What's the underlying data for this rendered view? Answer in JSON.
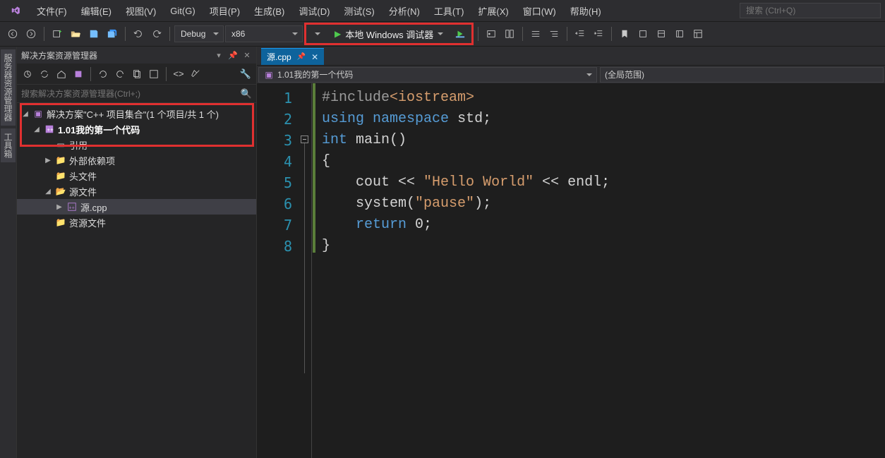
{
  "menu": {
    "file": "文件(F)",
    "edit": "编辑(E)",
    "view": "视图(V)",
    "git": "Git(G)",
    "project": "项目(P)",
    "build": "生成(B)",
    "debug": "调试(D)",
    "test": "测试(S)",
    "analyze": "分析(N)",
    "tools": "工具(T)",
    "extensions": "扩展(X)",
    "window": "窗口(W)",
    "help": "帮助(H)",
    "search_ph": "搜索 (Ctrl+Q)"
  },
  "toolbar": {
    "config": "Debug",
    "platform": "x86",
    "start": "本地 Windows 调试器"
  },
  "wells": {
    "a": "服务器资源管理器",
    "b": "工具箱"
  },
  "panel": {
    "title": "解决方案资源管理器",
    "search_ph": "搜索解决方案资源管理器(Ctrl+;)",
    "sln": "解决方案\"C++ 项目集合\"(1 个项目/共 1 个)",
    "proj": "1.01我的第一个代码",
    "refs": "引用",
    "ext": "外部依赖项",
    "hdr": "头文件",
    "src": "源文件",
    "file": "源.cpp",
    "res": "资源文件"
  },
  "editor": {
    "tab": "源.cpp",
    "nav_project": "1.01我的第一个代码",
    "nav_scope": "(全局范围)"
  },
  "code": {
    "l1a": "#include",
    "l1b": "<iostream>",
    "l2a": "using",
    "l2b": "namespace",
    "l2c": "std",
    "l2d": ";",
    "l3a": "int",
    "l3b": "main",
    "l3c": "()",
    "l4": "{",
    "l5a": "cout",
    "l5b": " << ",
    "l5c": "\"Hello World\"",
    "l5d": " << ",
    "l5e": "endl",
    "l5f": ";",
    "l6a": "system",
    "l6b": "(",
    "l6c": "\"pause\"",
    "l6d": ");",
    "l7a": "return",
    "l7b": " 0;",
    "l8": "}"
  },
  "lines": [
    "1",
    "2",
    "3",
    "4",
    "5",
    "6",
    "7",
    "8"
  ]
}
